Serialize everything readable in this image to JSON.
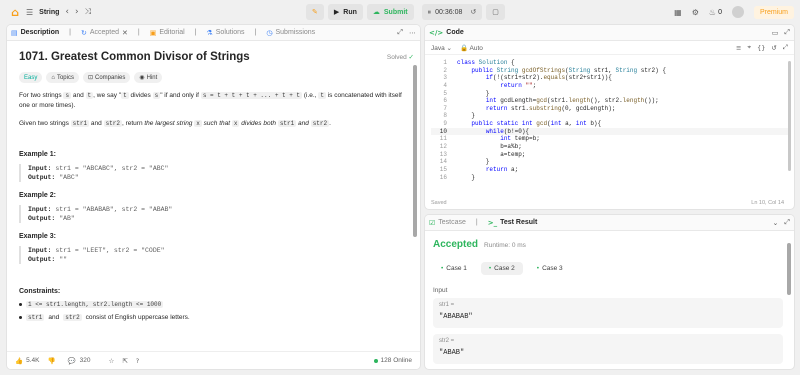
{
  "topbar": {
    "problem_list": "Problem List",
    "study_plan": "String",
    "run": "Run",
    "submit": "Submit",
    "timer": "00:36:08",
    "notifications_count": "0",
    "premium": "Premium"
  },
  "left_tabs": [
    {
      "label": "Description",
      "icon": "document-icon",
      "active": true
    },
    {
      "label": "Accepted",
      "icon": "history-icon",
      "active": false
    },
    {
      "label": "Editorial",
      "icon": "book-icon",
      "active": false
    },
    {
      "label": "Solutions",
      "icon": "flask-icon",
      "active": false
    },
    {
      "label": "Submissions",
      "icon": "clock-icon",
      "active": false
    }
  ],
  "problem": {
    "title": "1071. Greatest Common Divisor of Strings",
    "status": "Solved",
    "difficulty": "Easy",
    "topics": "Topics",
    "companies": "Companies",
    "hint": "Hint",
    "p1_a": "For two strings",
    "p1_s": "s",
    "p1_b": "and",
    "p1_t": "t",
    "p1_c": ", we say \"",
    "p1_t2": "t",
    "p1_d": "divides",
    "p1_s2": "s",
    "p1_e": "\" if and only if",
    "p1_expr": "s = t + t + t + ... + t + t",
    "p1_f": "(i.e.,",
    "p1_t3": "t",
    "p1_g": "is concatenated with itself one or more times).",
    "p2_a": "Given two strings",
    "p2_s1": "str1",
    "p2_b": "and",
    "p2_s2": "str2",
    "p2_c": ", return",
    "p2_d": "the largest string",
    "p2_x": "x",
    "p2_e": "such that",
    "p2_x2": "x",
    "p2_f": "divides both",
    "p2_s3": "str1",
    "p2_g": "and",
    "p2_s4": "str2",
    "p2_h": "."
  },
  "examples": [
    {
      "heading": "Example 1:",
      "input": "str1 = \"ABCABC\", str2 = \"ABC\"",
      "output": "\"ABC\""
    },
    {
      "heading": "Example 2:",
      "input": "str1 = \"ABABAB\", str2 = \"ABAB\"",
      "output": "\"AB\""
    },
    {
      "heading": "Example 3:",
      "input": "str1 = \"LEET\", str2 = \"CODE\"",
      "output": "\"\""
    }
  ],
  "labels": {
    "input": "Input:",
    "output": "Output:"
  },
  "constraints": {
    "heading": "Constraints:",
    "c1": "1 <= str1.length, str2.length <= 1000",
    "c2_a": "str1",
    "c2_b": "and",
    "c2_c": "str2",
    "c2_d": "consist of English uppercase letters."
  },
  "footer": {
    "likes": "5.4K",
    "comments": "320",
    "online": "128 Online"
  },
  "code_panel": {
    "title": "Code",
    "language": "Java",
    "auto": "Auto",
    "saved": "Saved",
    "cursor": "Ln 10, Col 14"
  },
  "result_panel": {
    "tab_testcase": "Testcase",
    "tab_result": "Test Result",
    "status": "Accepted",
    "runtime": "Runtime: 0 ms",
    "cases": [
      "Case 1",
      "Case 2",
      "Case 3"
    ],
    "input_label": "Input",
    "var1": "str1 =",
    "val1": "\"ABABAB\"",
    "var2": "str2 =",
    "val2": "\"ABAB\""
  }
}
